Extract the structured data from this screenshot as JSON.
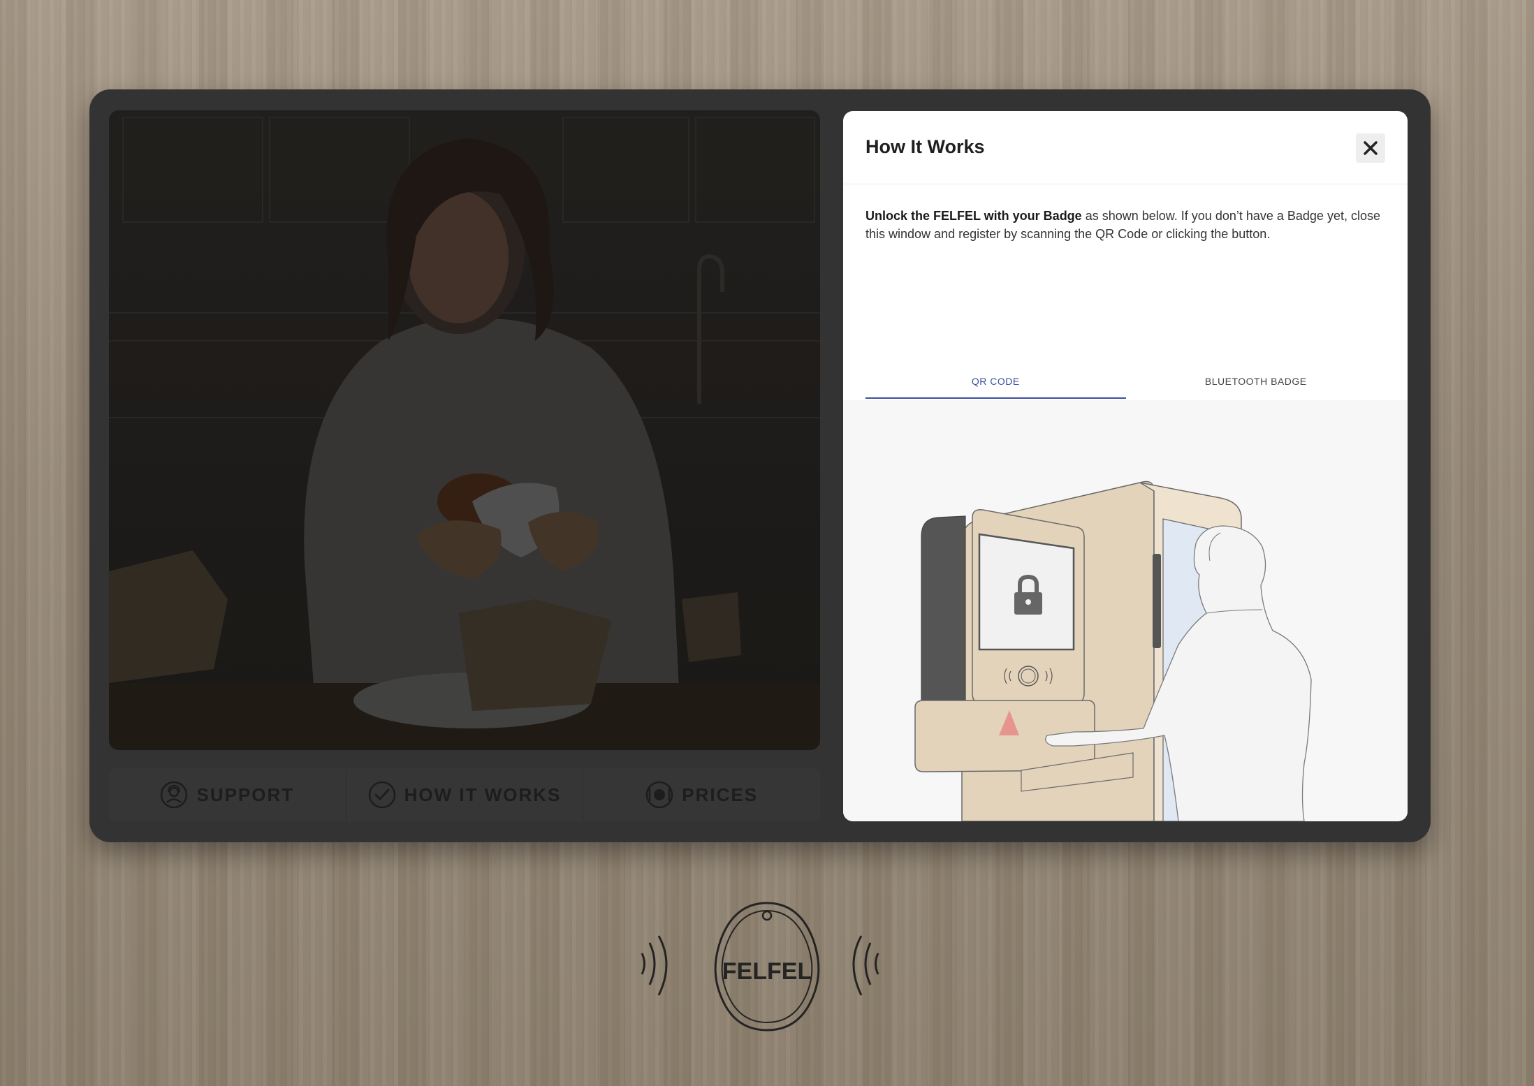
{
  "navigation": {
    "items": [
      {
        "label": "SUPPORT",
        "icon": "support-agent-icon"
      },
      {
        "label": "HOW IT WORKS",
        "icon": "check-circle-icon"
      },
      {
        "label": "PRICES",
        "icon": "plate-cutlery-icon"
      }
    ]
  },
  "modal": {
    "title": "How It Works",
    "intro_bold": "Unlock the FELFEL with your Badge",
    "intro_rest": " as shown below. If you don’t have a Badge yet, close this window and register by scanning the QR Code or clicking the button.",
    "tabs": [
      {
        "label": "QR CODE",
        "active": true
      },
      {
        "label": "BLUETOOTH BADGE",
        "active": false
      }
    ],
    "close_icon": "close-icon"
  },
  "badge": {
    "brand": "FELFEL"
  },
  "colors": {
    "device_frame": "#333333",
    "accent": "#3b4f9e",
    "fridge": "#e3d3bb",
    "background_wood": "#9d8f7e"
  }
}
